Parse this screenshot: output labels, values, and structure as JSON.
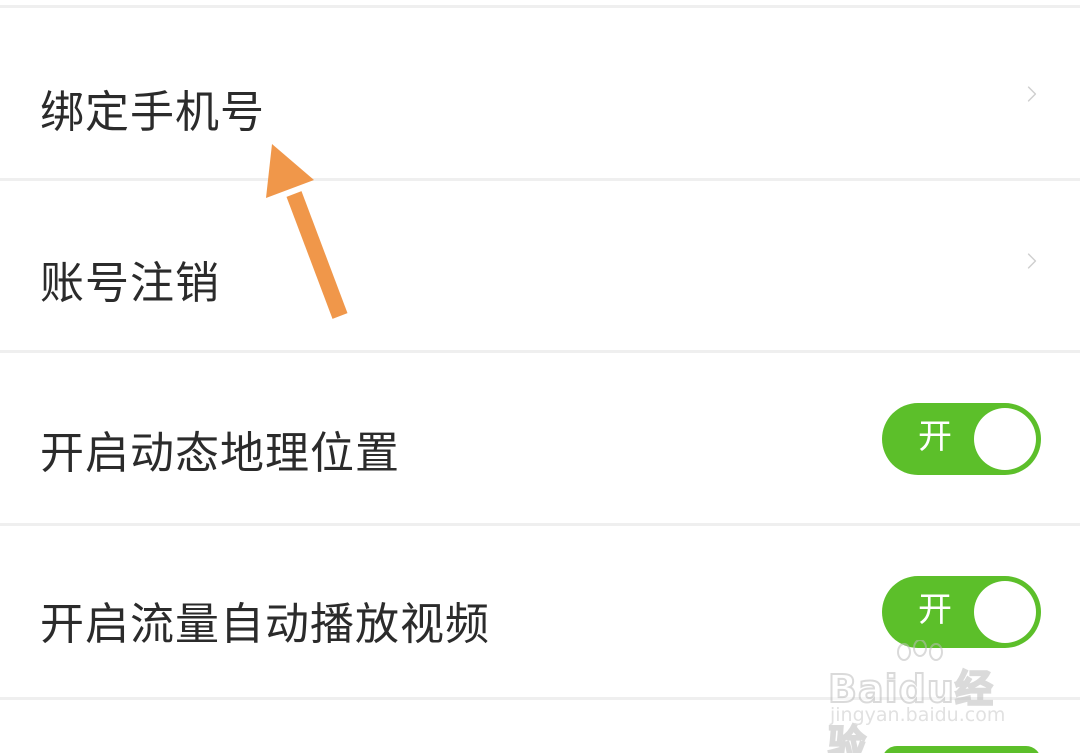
{
  "settings": {
    "items": [
      {
        "label": "绑定手机号",
        "type": "link"
      },
      {
        "label": "账号注销",
        "type": "link"
      },
      {
        "label": "开启动态地理位置",
        "type": "toggle",
        "toggle_text": "开",
        "on": true
      },
      {
        "label": "开启流量自动播放视频",
        "type": "toggle",
        "toggle_text": "开",
        "on": true
      }
    ]
  },
  "watermark": {
    "logo": "Baidu经验",
    "url": "jingyan.baidu.com"
  },
  "colors": {
    "toggle_on": "#5cbf2a",
    "annotation_arrow": "#f0974a",
    "divider": "#efefef",
    "text": "#2b2b2b"
  },
  "icons": [
    "chevron-right-icon",
    "annotation-arrow-icon"
  ]
}
